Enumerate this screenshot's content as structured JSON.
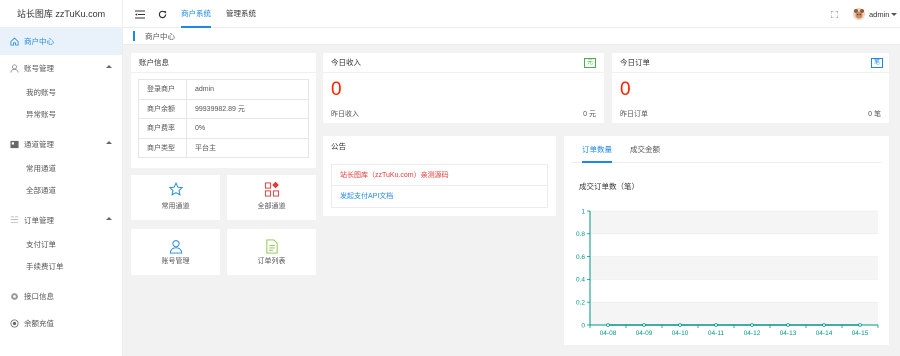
{
  "app": {
    "brand": "站长图库 zzTuKu.com"
  },
  "header": {
    "tabs": [
      {
        "label": "商户系统",
        "active": true
      },
      {
        "label": "管理系统",
        "active": false
      }
    ],
    "user": "admin"
  },
  "breadcrumb": "商户中心",
  "sidebar": {
    "items": [
      {
        "label": "商户中心",
        "icon": "home-icon",
        "active": true,
        "children": []
      },
      {
        "label": "账号管理",
        "icon": "user-icon",
        "children": [
          "我的账号",
          "异常账号"
        ]
      },
      {
        "label": "通道管理",
        "icon": "channel-icon",
        "children": [
          "常用通道",
          "全部通道"
        ]
      },
      {
        "label": "订单管理",
        "icon": "order-icon",
        "children": [
          "支付订单",
          "手续费订单"
        ]
      },
      {
        "label": "接口信息",
        "icon": "settings-icon",
        "children": []
      },
      {
        "label": "余额充值",
        "icon": "recharge-icon",
        "children": []
      }
    ]
  },
  "account": {
    "title": "账户信息",
    "rows": [
      {
        "key": "登录商户",
        "value": "admin"
      },
      {
        "key": "商户余额",
        "value": "99939982.89 元"
      },
      {
        "key": "商户费率",
        "value": "0%"
      },
      {
        "key": "商户类型",
        "value": "平台主"
      }
    ]
  },
  "shortcuts": [
    {
      "label": "常用通道",
      "icon": "star-icon"
    },
    {
      "label": "全部通道",
      "icon": "grid-icon"
    },
    {
      "label": "账号管理",
      "icon": "account-icon"
    },
    {
      "label": "订单列表",
      "icon": "list-icon"
    }
  ],
  "income": {
    "title": "今日收入",
    "badge": "元",
    "value": "0",
    "yesterday_label": "昨日收入",
    "yesterday_value": "0 元"
  },
  "orders": {
    "title": "今日订单",
    "badge": "笔",
    "value": "0",
    "yesterday_label": "昨日订单",
    "yesterday_value": "0 笔"
  },
  "notice": {
    "title": "公告",
    "items": [
      {
        "text": "站长图库（zzTuKu.com）亲测源码",
        "color": "#e53935"
      },
      {
        "text": "发起支付API文档",
        "color": "#1e88e5"
      }
    ]
  },
  "chart_tabs": [
    {
      "label": "订单数量",
      "active": true
    },
    {
      "label": "成交金额",
      "active": false
    }
  ],
  "chart_data": {
    "type": "area",
    "title": "成交订单数（笔）",
    "categories": [
      "04-08",
      "04-09",
      "04-10",
      "04-11",
      "04-12",
      "04-13",
      "04-14",
      "04-15"
    ],
    "values": [
      0,
      0,
      0,
      0,
      0,
      0,
      0,
      0
    ],
    "yticks": [
      "0",
      "0.2",
      "0.4",
      "0.6",
      "0.8",
      "1"
    ],
    "ylim": [
      0,
      1
    ],
    "grid": true,
    "color": "#009688"
  },
  "colors": {
    "accent": "#1e88e5",
    "red": "#ff2200",
    "green": "#009688"
  }
}
